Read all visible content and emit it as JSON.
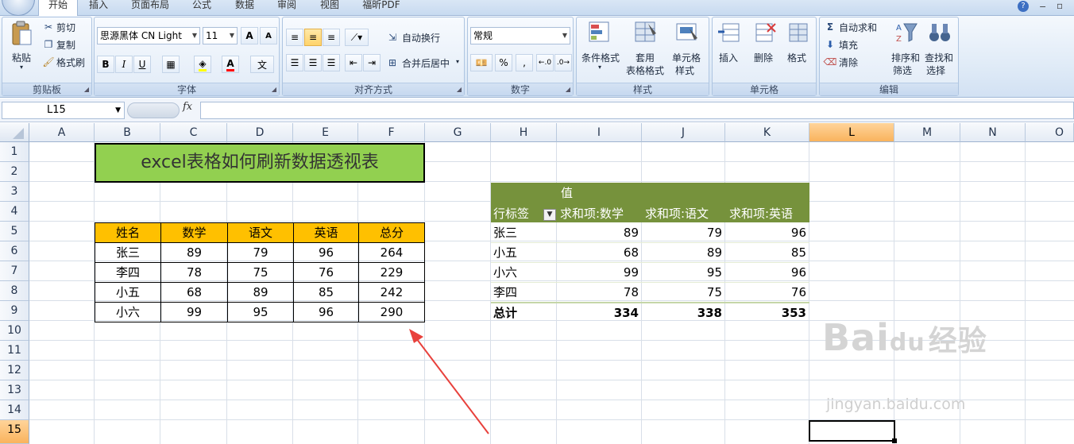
{
  "tabs": [
    "开始",
    "插入",
    "页面布局",
    "公式",
    "数据",
    "审阅",
    "视图",
    "福昕PDF"
  ],
  "clipboard": {
    "paste": "粘贴",
    "cut": "剪切",
    "copy": "复制",
    "format_painter": "格式刷",
    "label": "剪贴板"
  },
  "font": {
    "name": "思源黑体 CN Light",
    "size": "11",
    "label": "字体",
    "grow": "A",
    "shrink": "A",
    "bold": "B",
    "italic": "I",
    "underline": "U"
  },
  "alignment": {
    "wrap": "自动换行",
    "merge": "合并后居中",
    "label": "对齐方式"
  },
  "number": {
    "format": "常规",
    "label": "数字",
    "percent": "%",
    "comma": ","
  },
  "styles": {
    "conditional": "条件格式",
    "table1": "套用",
    "table2": "表格格式",
    "cell1": "单元格",
    "cell2": "样式",
    "label": "样式"
  },
  "cells": {
    "insert": "插入",
    "delete": "删除",
    "format": "格式",
    "label": "单元格"
  },
  "editing": {
    "autosum": "自动求和",
    "fill": "填充",
    "clear": "清除",
    "sort1": "排序和",
    "sort2": "筛选",
    "find1": "查找和",
    "find2": "选择",
    "label": "编辑"
  },
  "namebox": "L15",
  "fx": "fx",
  "columns": [
    "A",
    "B",
    "C",
    "D",
    "E",
    "F",
    "G",
    "H",
    "I",
    "J",
    "K",
    "L",
    "M",
    "N",
    "O"
  ],
  "rows": [
    "1",
    "2",
    "3",
    "4",
    "5",
    "6",
    "7",
    "8",
    "9",
    "10",
    "11",
    "12",
    "13",
    "14",
    "15"
  ],
  "title": "excel表格如何刷新数据透视表",
  "table": {
    "headers": [
      "姓名",
      "数学",
      "语文",
      "英语",
      "总分"
    ],
    "rows": [
      [
        "张三",
        "89",
        "79",
        "96",
        "264"
      ],
      [
        "李四",
        "78",
        "75",
        "76",
        "229"
      ],
      [
        "小五",
        "68",
        "89",
        "85",
        "242"
      ],
      [
        "小六",
        "99",
        "95",
        "96",
        "290"
      ]
    ]
  },
  "pivot": {
    "values_label": "值",
    "row_label": "行标签",
    "headers": [
      "求和项:数学",
      "求和项:语文",
      "求和项:英语"
    ],
    "rows": [
      [
        "张三",
        "89",
        "79",
        "96"
      ],
      [
        "小五",
        "68",
        "89",
        "85"
      ],
      [
        "小六",
        "99",
        "95",
        "96"
      ],
      [
        "李四",
        "78",
        "75",
        "76"
      ]
    ],
    "total": [
      "总计",
      "334",
      "338",
      "353"
    ]
  },
  "watermark": {
    "brand": "Bai",
    "brand2": "du",
    "cn": "经验",
    "url": "jingyan.baidu.com"
  },
  "colors": {
    "title_fill": "#92d050",
    "table_header": "#ffc000",
    "pivot_header": "#76923c",
    "arrow": "#e8413c"
  }
}
